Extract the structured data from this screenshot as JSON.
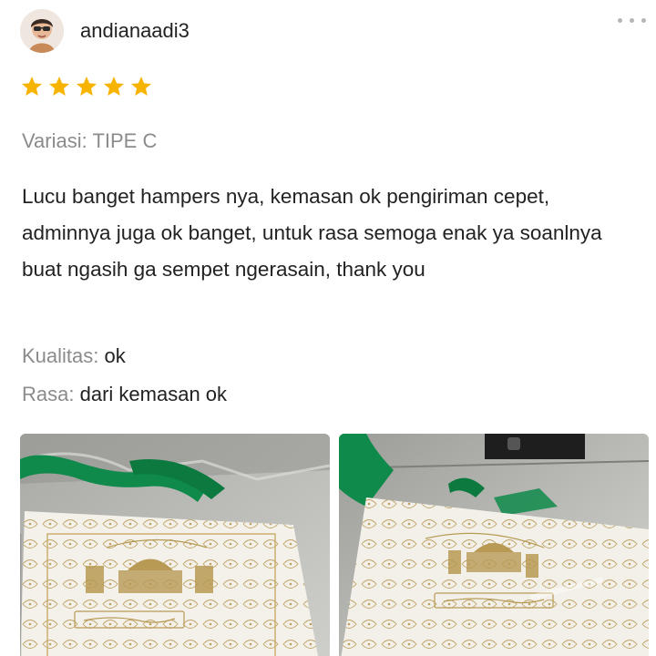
{
  "reviewer": {
    "username": "andianaadi3"
  },
  "rating": {
    "stars": 5,
    "max": 5,
    "color": "#f6b400"
  },
  "variation": {
    "label": "Variasi:",
    "value": "TIPE C"
  },
  "review_text": "Lucu banget hampers nya, kemasan ok pengiriman cepet, adminnya juga ok banget, untuk rasa semoga enak ya soanlnya buat ngasih ga sempet ngerasain, thank you",
  "details": [
    {
      "key": "Kualitas:",
      "value": "ok"
    },
    {
      "key": "Rasa:",
      "value": "dari kemasan ok"
    }
  ],
  "photos": [
    {
      "icon": "hamper-box-photo"
    },
    {
      "icon": "hamper-box-photo"
    }
  ],
  "colors": {
    "text": "#222222",
    "muted": "#8b8b8b",
    "accent_green": "#0f8a4a"
  }
}
